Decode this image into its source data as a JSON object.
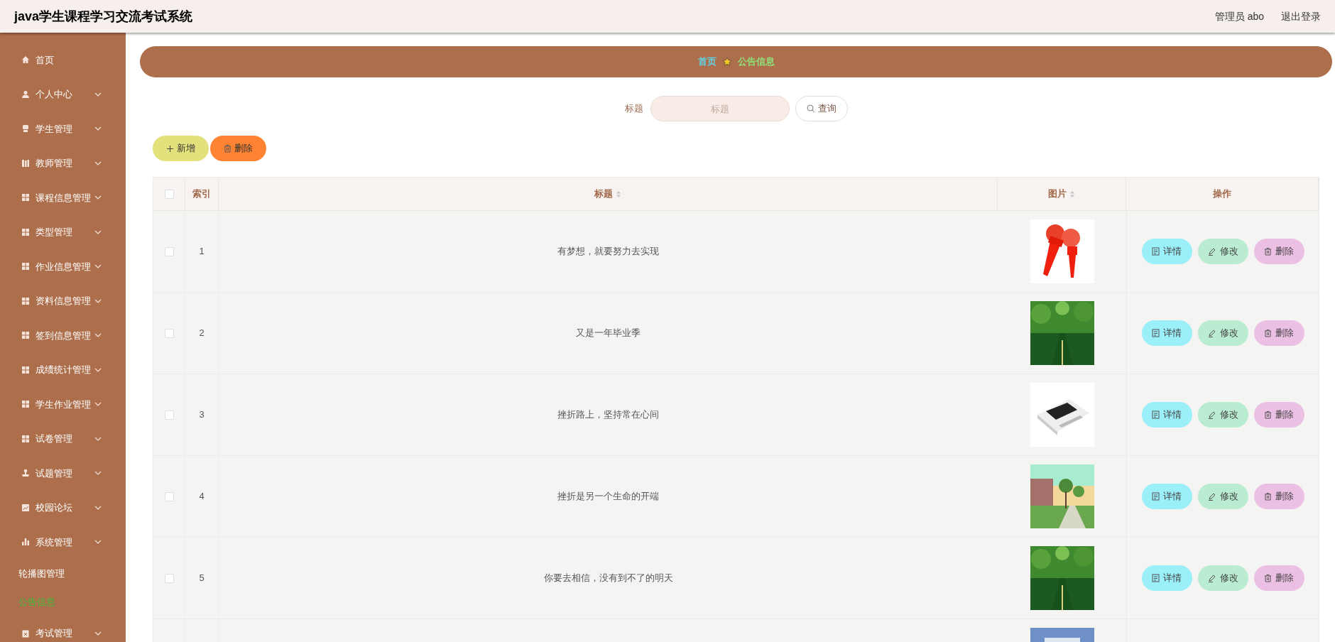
{
  "header": {
    "title": "java学生课程学习交流考试系统",
    "user": "管理员 abo",
    "logout": "退出登录"
  },
  "sidebar": {
    "items": [
      {
        "label": "首页",
        "expandable": false
      },
      {
        "label": "个人中心",
        "expandable": true
      },
      {
        "label": "学生管理",
        "expandable": true
      },
      {
        "label": "教师管理",
        "expandable": true
      },
      {
        "label": "课程信息管理",
        "expandable": true
      },
      {
        "label": "类型管理",
        "expandable": true
      },
      {
        "label": "作业信息管理",
        "expandable": true
      },
      {
        "label": "资料信息管理",
        "expandable": true
      },
      {
        "label": "签到信息管理",
        "expandable": true
      },
      {
        "label": "成绩统计管理",
        "expandable": true
      },
      {
        "label": "学生作业管理",
        "expandable": true
      },
      {
        "label": "试卷管理",
        "expandable": true
      },
      {
        "label": "试题管理",
        "expandable": true
      },
      {
        "label": "校园论坛",
        "expandable": true
      },
      {
        "label": "系统管理",
        "expandable": true,
        "children": [
          {
            "label": "轮播图管理",
            "selected": false
          },
          {
            "label": "公告信息",
            "selected": true
          }
        ]
      },
      {
        "label": "考试管理",
        "expandable": true
      }
    ]
  },
  "breadcrumb": [
    "首页",
    "公告信息"
  ],
  "search": {
    "label": "标题",
    "placeholder": "标题",
    "button": "查询"
  },
  "actions": [
    {
      "label": "新增",
      "kind": "add"
    },
    {
      "label": "删除",
      "kind": "delete"
    }
  ],
  "table": {
    "select_all_checked": false,
    "columns": [
      {
        "label": "索引",
        "sortable": false
      },
      {
        "label": "标题",
        "sortable": true
      },
      {
        "label": "图片",
        "sortable": true
      },
      {
        "label": "操作",
        "sortable": false
      }
    ],
    "rows": [
      {
        "index": "1",
        "title": "有梦想，就要努力去实现",
        "checked": false,
        "buttons": [
          {
            "label": "详情",
            "kind": "detail"
          },
          {
            "label": "修改",
            "kind": "edit"
          },
          {
            "label": "删除",
            "kind": "delete"
          }
        ]
      },
      {
        "index": "2",
        "title": "又是一年毕业季",
        "checked": false,
        "buttons": [
          {
            "label": "详情",
            "kind": "detail"
          },
          {
            "label": "修改",
            "kind": "edit"
          },
          {
            "label": "删除",
            "kind": "delete"
          }
        ]
      },
      {
        "index": "3",
        "title": "挫折路上，坚持常在心间",
        "checked": false,
        "buttons": [
          {
            "label": "详情",
            "kind": "detail"
          },
          {
            "label": "修改",
            "kind": "edit"
          },
          {
            "label": "删除",
            "kind": "delete"
          }
        ]
      },
      {
        "index": "4",
        "title": "挫折是另一个生命的开端",
        "checked": false,
        "buttons": [
          {
            "label": "详情",
            "kind": "detail"
          },
          {
            "label": "修改",
            "kind": "edit"
          },
          {
            "label": "删除",
            "kind": "delete"
          }
        ]
      },
      {
        "index": "5",
        "title": "你要去相信，没有到不了的明天",
        "checked": false,
        "buttons": [
          {
            "label": "详情",
            "kind": "detail"
          },
          {
            "label": "修改",
            "kind": "edit"
          },
          {
            "label": "删除",
            "kind": "delete"
          }
        ]
      }
    ]
  }
}
